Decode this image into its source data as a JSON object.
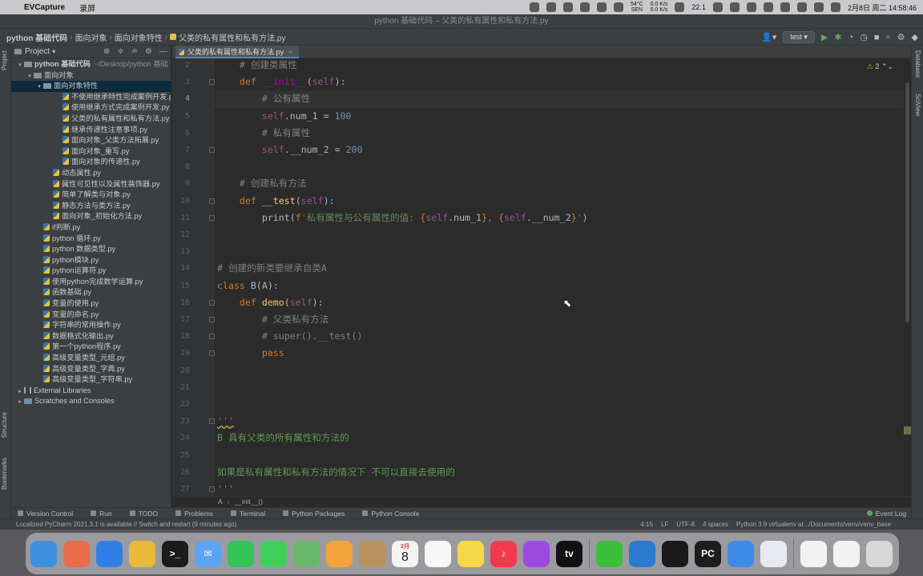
{
  "menubar": {
    "app_name": "EVCapture",
    "menus": [
      "录屏"
    ],
    "temperature": "54°C",
    "temp_sub": "SEN",
    "net_up": "0.0 K/s",
    "net_down": "0.0 K/s",
    "battery_pct": "22.1",
    "datetime": "2月8日 周二  14:58:46"
  },
  "window": {
    "title": "python 基础代码 – 父类的私有属性和私有方法.py"
  },
  "navbar": {
    "crumbs": [
      "python 基础代码",
      "面向对象",
      "面向对象特性",
      "父类的私有属性和私有方法.py"
    ],
    "run_config": "test"
  },
  "project_panel": {
    "title": "Project",
    "tree": [
      {
        "indent": 0,
        "type": "folder",
        "open": true,
        "label": "python 基础代码",
        "hint": "~/Desktop/python 基础"
      },
      {
        "indent": 1,
        "type": "folder",
        "open": true,
        "label": "面向对象"
      },
      {
        "indent": 2,
        "type": "folder",
        "open": true,
        "label": "面向对象特性",
        "selected": true
      },
      {
        "indent": 4,
        "type": "py",
        "label": "不使用继承特性完成案例开发.py"
      },
      {
        "indent": 4,
        "type": "py",
        "label": "使用继承方式完成案例开发.py"
      },
      {
        "indent": 4,
        "type": "py",
        "label": "父类的私有属性和私有方法.py"
      },
      {
        "indent": 4,
        "type": "py",
        "label": "继承传递性注意事项.py"
      },
      {
        "indent": 4,
        "type": "py",
        "label": "面向对象_父类方法拓展.py"
      },
      {
        "indent": 4,
        "type": "py",
        "label": "面向对象_重写.py"
      },
      {
        "indent": 4,
        "type": "py",
        "label": "面向对象的传递性.py"
      },
      {
        "indent": 3,
        "type": "py",
        "label": "动态属性.py"
      },
      {
        "indent": 3,
        "type": "py",
        "label": "属性可见性以及属性装饰器.py"
      },
      {
        "indent": 3,
        "type": "py",
        "label": "简单了解类与对象.py"
      },
      {
        "indent": 3,
        "type": "py",
        "label": "静态方法与类方法.py"
      },
      {
        "indent": 3,
        "type": "py",
        "label": "面向对象_初始化方法.py"
      },
      {
        "indent": 2,
        "type": "py",
        "label": "if判断.py"
      },
      {
        "indent": 2,
        "type": "py",
        "label": "python 循环.py"
      },
      {
        "indent": 2,
        "type": "py",
        "label": "python 数据类型.py"
      },
      {
        "indent": 2,
        "type": "py",
        "label": "python模块.py"
      },
      {
        "indent": 2,
        "type": "py",
        "label": "python运算符.py"
      },
      {
        "indent": 2,
        "type": "py",
        "label": "使用python完成数学运算.py"
      },
      {
        "indent": 2,
        "type": "py",
        "label": "函数基础.py"
      },
      {
        "indent": 2,
        "type": "py",
        "label": "变量的使用.py"
      },
      {
        "indent": 2,
        "type": "py",
        "label": "变量的命名.py"
      },
      {
        "indent": 2,
        "type": "py",
        "label": "字符串的常用操作.py"
      },
      {
        "indent": 2,
        "type": "py",
        "label": "数据格式化输出.py"
      },
      {
        "indent": 2,
        "type": "py",
        "label": "第一个python程序.py"
      },
      {
        "indent": 2,
        "type": "py",
        "label": "高级变量类型_元组.py"
      },
      {
        "indent": 2,
        "type": "py",
        "label": "高级变量类型_字典.py"
      },
      {
        "indent": 2,
        "type": "py",
        "label": "高级变量类型_字符串.py"
      },
      {
        "indent": 0,
        "type": "lib",
        "open": false,
        "label": "External Libraries"
      },
      {
        "indent": 0,
        "type": "scratch",
        "open": false,
        "label": "Scratches and Consoles"
      }
    ]
  },
  "editor": {
    "tab_label": "父类的私有属性和私有方法.py",
    "inspection_count": "2",
    "current_line": 4,
    "lines": [
      {
        "n": "2",
        "tokens": [
          {
            "t": "    "
          },
          {
            "c": "cm",
            "t": "# 创建类属性"
          }
        ]
      },
      {
        "n": "3",
        "tokens": [
          {
            "t": "    "
          },
          {
            "c": "kw",
            "t": "def "
          },
          {
            "c": "dm",
            "t": "__init__"
          },
          {
            "t": "("
          },
          {
            "c": "sl",
            "t": "self"
          },
          {
            "t": "):"
          }
        ]
      },
      {
        "n": "4",
        "tokens": [
          {
            "t": "        "
          },
          {
            "c": "cm",
            "t": "# 公有属性"
          }
        ]
      },
      {
        "n": "5",
        "tokens": [
          {
            "t": "        "
          },
          {
            "c": "sl",
            "t": "self"
          },
          {
            "t": ".num_1 = "
          },
          {
            "c": "nm",
            "t": "100"
          }
        ]
      },
      {
        "n": "6",
        "tokens": [
          {
            "t": "        "
          },
          {
            "c": "cm",
            "t": "# 私有属性"
          }
        ]
      },
      {
        "n": "7",
        "tokens": [
          {
            "t": "        "
          },
          {
            "c": "sl",
            "t": "self"
          },
          {
            "t": ".__num_2 = "
          },
          {
            "c": "nm",
            "t": "200"
          }
        ]
      },
      {
        "n": "8",
        "tokens": []
      },
      {
        "n": "9",
        "tokens": [
          {
            "t": "    "
          },
          {
            "c": "cm",
            "t": "# 创建私有方法"
          }
        ]
      },
      {
        "n": "10",
        "tokens": [
          {
            "t": "    "
          },
          {
            "c": "kw",
            "t": "def "
          },
          {
            "c": "fn",
            "t": "__test"
          },
          {
            "t": "("
          },
          {
            "c": "sl",
            "t": "self"
          },
          {
            "t": "):"
          }
        ]
      },
      {
        "n": "11",
        "tokens": [
          {
            "t": "        print("
          },
          {
            "c": "kw",
            "t": "f"
          },
          {
            "c": "st",
            "t": "'私有属性与公有属性的值: "
          },
          {
            "c": "kw",
            "t": "{"
          },
          {
            "c": "sl",
            "t": "self"
          },
          {
            "t": ".num_1"
          },
          {
            "c": "kw",
            "t": "}"
          },
          {
            "c": "st",
            "t": ", "
          },
          {
            "c": "kw",
            "t": "{"
          },
          {
            "c": "sl",
            "t": "self"
          },
          {
            "t": ".__num_2"
          },
          {
            "c": "kw",
            "t": "}"
          },
          {
            "c": "st",
            "t": "'"
          },
          {
            "t": ")"
          }
        ]
      },
      {
        "n": "12",
        "tokens": []
      },
      {
        "n": "13",
        "tokens": []
      },
      {
        "n": "14",
        "tokens": [
          {
            "c": "cm",
            "t": "# 创建的新类要继承自类A"
          }
        ]
      },
      {
        "n": "15",
        "tokens": [
          {
            "c": "kw",
            "t": "class "
          },
          {
            "t": "B(A):"
          }
        ]
      },
      {
        "n": "16",
        "tokens": [
          {
            "t": "    "
          },
          {
            "c": "kw",
            "t": "def "
          },
          {
            "c": "fn",
            "t": "demo"
          },
          {
            "t": "("
          },
          {
            "c": "sl",
            "t": "self"
          },
          {
            "t": "):"
          }
        ]
      },
      {
        "n": "17",
        "tokens": [
          {
            "t": "        "
          },
          {
            "c": "cm",
            "t": "# 父类私有方法"
          }
        ]
      },
      {
        "n": "18",
        "tokens": [
          {
            "t": "        "
          },
          {
            "c": "cm",
            "t": "# super().__test()"
          }
        ]
      },
      {
        "n": "19",
        "tokens": [
          {
            "t": "        "
          },
          {
            "c": "kw",
            "t": "pass"
          }
        ]
      },
      {
        "n": "20",
        "tokens": []
      },
      {
        "n": "21",
        "tokens": []
      },
      {
        "n": "22",
        "tokens": []
      },
      {
        "n": "23",
        "tokens": [
          {
            "c": "wav",
            "t": "'''"
          }
        ]
      },
      {
        "n": "24",
        "tokens": [
          {
            "c": "dc",
            "t": "B 具有父类的所有属性和方法的"
          }
        ]
      },
      {
        "n": "25",
        "tokens": []
      },
      {
        "n": "26",
        "tokens": [
          {
            "c": "dc",
            "t": "如果是私有属性和私有方法的情况下 不可以直接去使用的"
          }
        ]
      },
      {
        "n": "27",
        "tokens": [
          {
            "c": "dc",
            "t": "'''"
          }
        ]
      }
    ],
    "breadcrumb": [
      "A",
      "__init__()"
    ]
  },
  "tool_windows": [
    "Version Control",
    "Run",
    "TODO",
    "Problems",
    "Terminal",
    "Python Packages",
    "Python Console"
  ],
  "event_log": "Event Log",
  "side_labels": {
    "left_top": "Project",
    "left_mid": "Structure",
    "left_bottom": "Bookmarks",
    "right_top": "Database",
    "right_mid": "SciView"
  },
  "statusbar": {
    "message": "Localized PyCharm 2021.3.1 is available // Switch and restart (9 minutes ago)",
    "position": "4:15",
    "line_sep": "LF",
    "encoding": "UTF-8",
    "indent": "4 spaces",
    "interpreter": "Python 3.9 virtualenv at.../Documents/venv/venv_base"
  },
  "dock": {
    "calendar_month": "2月",
    "calendar_day": "8",
    "apps": [
      {
        "name": "finder",
        "color": "#3d8fe0",
        "glyph": ""
      },
      {
        "name": "launchpad",
        "color": "#e86d4a",
        "glyph": ""
      },
      {
        "name": "safari",
        "color": "#2f7ee6",
        "glyph": ""
      },
      {
        "name": "chrome",
        "color": "#e9b93a",
        "glyph": ""
      },
      {
        "name": "terminal",
        "color": "#1c1c1c",
        "glyph": ">_"
      },
      {
        "name": "mail",
        "color": "#5ca3f2",
        "glyph": "✉"
      },
      {
        "name": "facetime",
        "color": "#34c25a",
        "glyph": ""
      },
      {
        "name": "messages",
        "color": "#3fcf5a",
        "glyph": ""
      },
      {
        "name": "maps",
        "color": "#69b86b",
        "glyph": ""
      },
      {
        "name": "photos",
        "color": "#f2a33a",
        "glyph": ""
      },
      {
        "name": "contacts",
        "color": "#b8925e",
        "glyph": ""
      },
      {
        "name": "calendar",
        "color": "#f4f4f4",
        "glyph": ""
      },
      {
        "name": "reminders",
        "color": "#f7f7f7",
        "glyph": ""
      },
      {
        "name": "notes",
        "color": "#f7d74a",
        "glyph": ""
      },
      {
        "name": "music",
        "color": "#f2394e",
        "glyph": "♪"
      },
      {
        "name": "podcasts",
        "color": "#9a4ae0",
        "glyph": ""
      },
      {
        "name": "apple-tv",
        "color": "#111111",
        "glyph": "tv"
      },
      {
        "name": "wechat",
        "color": "#3bbf3a",
        "glyph": ""
      },
      {
        "name": "vscode",
        "color": "#2b7ad0",
        "glyph": ""
      },
      {
        "name": "qq",
        "color": "#1a1a1a",
        "glyph": ""
      },
      {
        "name": "pycharm",
        "color": "#1d1d1d",
        "glyph": "PC"
      },
      {
        "name": "baidu-netdisk",
        "color": "#3d8be8",
        "glyph": ""
      },
      {
        "name": "evcapture",
        "color": "#e8e8ef",
        "glyph": ""
      },
      {
        "name": "recent-window",
        "color": "#f2f2f2",
        "glyph": ""
      },
      {
        "name": "recent-window-2",
        "color": "#f2f2f2",
        "glyph": ""
      },
      {
        "name": "trash",
        "color": "#d8d8d8",
        "glyph": ""
      }
    ]
  }
}
